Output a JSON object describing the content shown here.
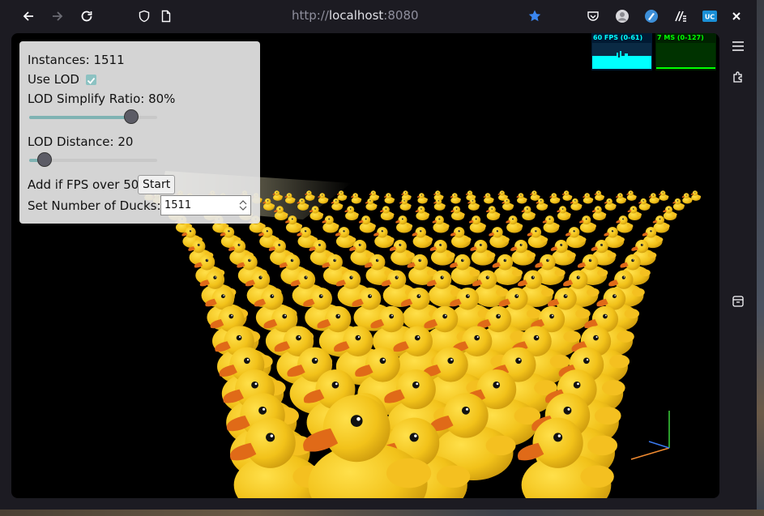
{
  "browser": {
    "url_scheme": "http://",
    "url_host": "localhost",
    "url_port": ":8080"
  },
  "panel": {
    "instances_label": "Instances: 1511",
    "use_lod_label": "Use LOD",
    "use_lod_checked": true,
    "lod_ratio_label": "LOD Simplify Ratio: 80%",
    "lod_ratio_value": 0.8,
    "lod_distance_label": "LOD Distance: 20",
    "lod_distance_value": 0.12,
    "add_fps_label": "Add if FPS over 50",
    "start_label": "Start",
    "set_ducks_label": "Set Number of Ducks:",
    "ducks_value": "1511"
  },
  "stats": {
    "fps_label": "60 FPS (0-61)",
    "ms_label": "7 MS (0-127)",
    "fps_color": "#00ffff",
    "ms_color": "#00ff00"
  },
  "icons": [
    "back-arrow-icon",
    "forward-arrow-icon",
    "reload-icon",
    "shield-icon",
    "page-icon",
    "bookmark-star-icon",
    "pocket-icon",
    "account-icon",
    "extension-icon",
    "reader-icon",
    "uc-icon",
    "close-icon",
    "menu-icon",
    "extension-panel-icon",
    "archive-icon",
    "axes-helper-icon"
  ],
  "colors": {
    "duck": "#f2c21a",
    "beak": "#e06a18",
    "accent": "#0060df"
  }
}
